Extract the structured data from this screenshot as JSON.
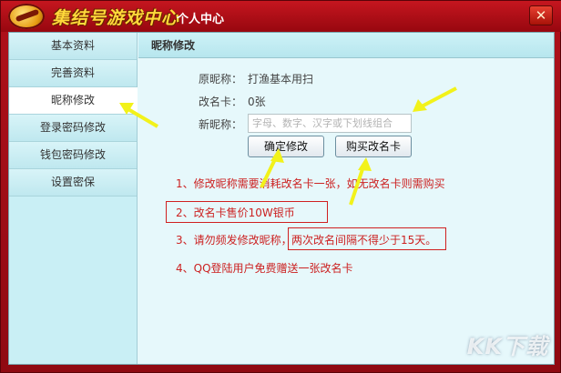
{
  "window": {
    "app_title": "集结号游戏中心",
    "section_title": "个人中心",
    "close_symbol": "✕"
  },
  "sidebar": {
    "items": [
      {
        "label": "基本资料"
      },
      {
        "label": "完善资料"
      },
      {
        "label": "昵称修改"
      },
      {
        "label": "登录密码修改"
      },
      {
        "label": "钱包密码修改"
      },
      {
        "label": "设置密保"
      }
    ],
    "active_index": 2
  },
  "panel": {
    "header": "昵称修改",
    "original_nick_label": "原昵称：",
    "original_nick_value": "打渔基本用扫",
    "rename_card_label": "改名卡：",
    "rename_card_value": "0张",
    "new_nick_label": "新昵称：",
    "new_nick_placeholder": "字母、数字、汉字或下划线组合",
    "confirm_button": "确定修改",
    "buy_card_button": "购买改名卡"
  },
  "notes": [
    "1、修改昵称需要消耗改名卡一张，如无改名卡则需购买",
    "2、改名卡售价10W银币",
    "3、请勿频发修改昵称，",
    "两次改名间隔不得少于15天。",
    "4、QQ登陆用户免费赠送一张改名卡"
  ],
  "watermark": "KK下载",
  "colors": {
    "frame_red": "#b0111b",
    "title_yellow": "#ffd93a",
    "sidebar_bg": "#c9eff5",
    "content_bg": "#e6f8fb",
    "note_red": "#cc2222",
    "arrow_yellow": "#f2f21a"
  }
}
